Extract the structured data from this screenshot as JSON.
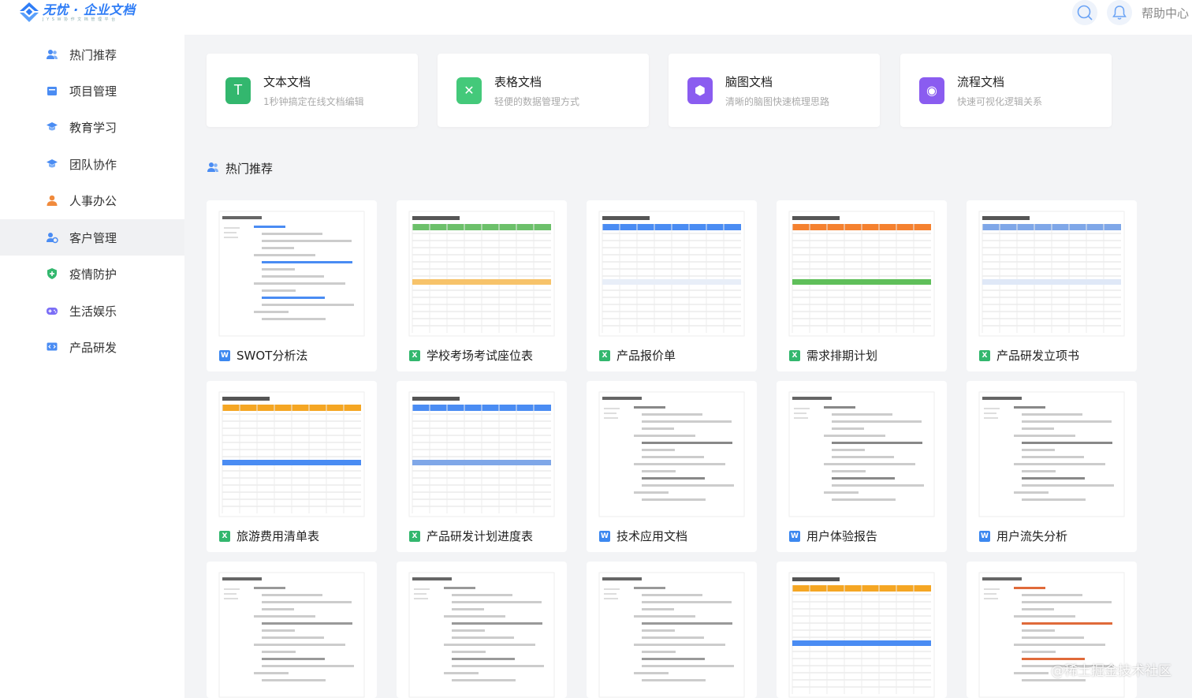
{
  "app": {
    "logo_title": "无忧 · 企业文档",
    "logo_sub": "J Y S W 协 作 文 档 管 理 平 台",
    "help_label": "帮助中心"
  },
  "sidebar": {
    "items": [
      {
        "label": "热门推荐",
        "icon": "users-icon",
        "color": "#4a8cf3"
      },
      {
        "label": "项目管理",
        "icon": "folder-icon",
        "color": "#4a8cf3"
      },
      {
        "label": "教育学习",
        "icon": "graduation-cap-icon",
        "color": "#4a8cf3"
      },
      {
        "label": "团队协作",
        "icon": "graduation-cap-icon",
        "color": "#4a8cf3"
      },
      {
        "label": "人事办公",
        "icon": "person-icon",
        "color": "#f08a3c"
      },
      {
        "label": "客户管理",
        "icon": "client-icon",
        "color": "#4a8cf3"
      },
      {
        "label": "疫情防护",
        "icon": "shield-icon",
        "color": "#33b76e"
      },
      {
        "label": "生活娱乐",
        "icon": "gamepad-icon",
        "color": "#7b6ef6"
      },
      {
        "label": "产品研发",
        "icon": "code-monitor-icon",
        "color": "#4a8cf3"
      }
    ],
    "active_index": 5
  },
  "doc_types": [
    {
      "title": "文本文档",
      "desc": "1秒钟搞定在线文档编辑",
      "icon": "text-doc-icon",
      "color": "#33b76e",
      "glyph": "T"
    },
    {
      "title": "表格文档",
      "desc": "轻便的数据管理方式",
      "icon": "table-doc-icon",
      "color": "#44c97a",
      "glyph": "✕"
    },
    {
      "title": "脑图文档",
      "desc": "清晰的脑图快速梳理思路",
      "icon": "mindmap-doc-icon",
      "color": "#8a5cf0",
      "glyph": "⬢"
    },
    {
      "title": "流程文档",
      "desc": "快速可视化逻辑关系",
      "icon": "flow-doc-icon",
      "color": "#8a5cf0",
      "glyph": "◉"
    }
  ],
  "section": {
    "title": "热门推荐",
    "icon": "users-icon"
  },
  "templates": [
    {
      "name": "SWOT分析法",
      "type": "word"
    },
    {
      "name": "学校考场考试座位表",
      "type": "excel"
    },
    {
      "name": "产品报价单",
      "type": "excel"
    },
    {
      "name": "需求排期计划",
      "type": "excel"
    },
    {
      "name": "产品研发立项书",
      "type": "excel"
    },
    {
      "name": "旅游费用清单表",
      "type": "excel"
    },
    {
      "name": "产品研发计划进度表",
      "type": "excel"
    },
    {
      "name": "技术应用文档",
      "type": "word"
    },
    {
      "name": "用户体验报告",
      "type": "word"
    },
    {
      "name": "用户流失分析",
      "type": "word"
    },
    {
      "name": "",
      "type": "word"
    },
    {
      "name": "",
      "type": "word"
    },
    {
      "name": "",
      "type": "word"
    },
    {
      "name": "",
      "type": "excel"
    },
    {
      "name": "",
      "type": "word"
    }
  ],
  "file_badges": {
    "word": "W",
    "excel": "X"
  },
  "watermark": "@稀土掘金技术社区"
}
